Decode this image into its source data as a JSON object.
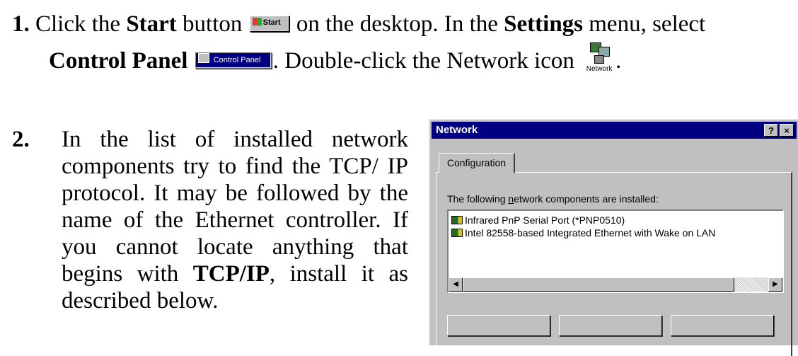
{
  "step1": {
    "number": "1.",
    "t1": "Click the",
    "start_bold": "Start",
    "t2": "button",
    "start_btn_label": "Start",
    "t3": "on the desktop. In the",
    "settings_bold": "Settings",
    "t4": "menu, select",
    "cp_bold": "Control Panel",
    "cp_btn_label": "Control Panel",
    "t5": ". Double-click the Network icon",
    "network_icon_caption": "Network",
    "t6": "."
  },
  "step2": {
    "number": "2.",
    "t1": "In the list of installed network components try to find the TCP/ IP protocol. It may be followed by the name of the Ethernet controller. If you cannot locate anything that begins with",
    "tcpip_bold": "TCP/IP",
    "t2": ", install it as described below."
  },
  "dialog": {
    "title": "Network",
    "help_button": "?",
    "close_button": "×",
    "tab_label": "Configuration",
    "section_label_pre": "The following ",
    "section_label_accel": "n",
    "section_label_post": "etwork components are installed:",
    "components": [
      "Infrared PnP Serial Port (*PNP0510)",
      "Intel 82558-based Integrated Ethernet with Wake on LAN"
    ],
    "icons": {
      "component": "network-adapter-icon",
      "scroll_left": "◀",
      "scroll_right": "▶"
    }
  },
  "colors": {
    "title_bar": "#000080",
    "dialog_face": "#c0c0c0"
  }
}
